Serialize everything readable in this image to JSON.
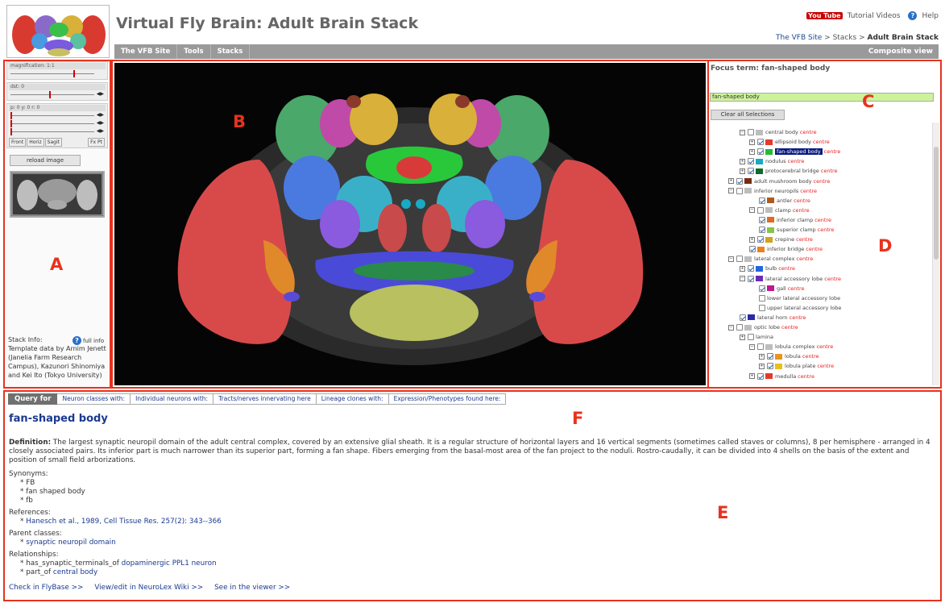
{
  "header": {
    "title": "Virtual Fly Brain: Adult Brain Stack",
    "tutorial_label": "Tutorial Videos",
    "help_label": "Help",
    "youtube_label": "You Tube",
    "breadcrumb": {
      "site": "The VFB Site",
      "sep1": ">",
      "stacks": "Stacks",
      "sep2": ">",
      "current": "Adult Brain Stack"
    }
  },
  "nav": {
    "items": [
      "The VFB Site",
      "Tools",
      "Stacks"
    ],
    "view_label": "Composite view"
  },
  "controls": {
    "magnification_label": "magnification: 1:1",
    "dst_label": "dst: 0",
    "pyr_label": "p: 0   y: 0   r: 0",
    "view_buttons": [
      "Front",
      "Horiz",
      "Sagit"
    ],
    "fx_button": "Fx Pt",
    "reload_button": "reload image"
  },
  "stack_info": {
    "label": "Stack Info:",
    "full_info": "full info",
    "text": "Template data by Arnim Jenett (Janelia Farm Research Campus), Kazunori Shinomiya and Kei Ito (Tokyo University)"
  },
  "focus": {
    "label": "Focus term: fan-shaped body",
    "input_value": "fan-shaped body",
    "clear_button": "Clear all Selections"
  },
  "tree": {
    "centre_label": "centre",
    "items": [
      {
        "label": "central body",
        "expander": "−",
        "checked": false,
        "color": "#bdbdbd",
        "centre": true
      },
      {
        "label": "ellipsoid body",
        "expander": "+",
        "checked": true,
        "color": "#e33b2e",
        "centre": true
      },
      {
        "label": "fan-shaped body",
        "expander": "+",
        "checked": true,
        "color": "#22bb33",
        "centre": true,
        "selected": true
      },
      {
        "label": "nodulus",
        "expander": "+",
        "checked": true,
        "color": "#18a9c4",
        "centre": true
      },
      {
        "label": "protocerebral bridge",
        "expander": "+",
        "checked": true,
        "color": "#0f6b2a",
        "centre": true
      },
      {
        "label": "adult mushroom body",
        "expander": "+",
        "checked": true,
        "color": "#7a2a14",
        "centre": true
      },
      {
        "label": "inferior neuropils",
        "expander": "−",
        "checked": false,
        "color": "#bdbdbd",
        "centre": true
      },
      {
        "label": "antler",
        "expander": "",
        "checked": true,
        "color": "#b05a1e",
        "centre": true
      },
      {
        "label": "clamp",
        "expander": "−",
        "checked": false,
        "color": "#bdbdbd",
        "centre": true
      },
      {
        "label": "inferior clamp",
        "expander": "",
        "checked": true,
        "color": "#e06a22",
        "centre": true
      },
      {
        "label": "superior clamp",
        "expander": "",
        "checked": true,
        "color": "#8bc34a",
        "centre": true
      },
      {
        "label": "crepine",
        "expander": "+",
        "checked": true,
        "color": "#d2a21a",
        "centre": true
      },
      {
        "label": "inferior bridge",
        "expander": "",
        "checked": true,
        "color": "#e8841e",
        "centre": true
      },
      {
        "label": "lateral complex",
        "expander": "−",
        "checked": false,
        "color": "#bdbdbd",
        "centre": true
      },
      {
        "label": "bulb",
        "expander": "+",
        "checked": true,
        "color": "#2266dd",
        "centre": true
      },
      {
        "label": "lateral accessory lobe",
        "expander": "−",
        "checked": true,
        "color": "#6a2bb5",
        "centre": true
      },
      {
        "label": "gall",
        "expander": "",
        "checked": true,
        "color": "#c2188d",
        "centre": true
      },
      {
        "label": "lower lateral accessory lobe",
        "expander": "",
        "checked": false,
        "color": "",
        "centre": false
      },
      {
        "label": "upper lateral accessory lobe",
        "expander": "",
        "checked": false,
        "color": "",
        "centre": false
      },
      {
        "label": "lateral horn",
        "expander": "",
        "checked": true,
        "color": "#2a2aa8",
        "centre": true
      },
      {
        "label": "optic lobe",
        "expander": "−",
        "checked": false,
        "color": "#bdbdbd",
        "centre": true
      },
      {
        "label": "lamina",
        "expander": "+",
        "checked": false,
        "color": "",
        "centre": false
      },
      {
        "label": "lobula complex",
        "expander": "−",
        "checked": false,
        "color": "#bdbdbd",
        "centre": true
      },
      {
        "label": "lobula",
        "expander": "+",
        "checked": true,
        "color": "#e8941e",
        "centre": true
      },
      {
        "label": "lobula plate",
        "expander": "+",
        "checked": true,
        "color": "#e8c01e",
        "centre": true
      },
      {
        "label": "medulla",
        "expander": "+",
        "checked": true,
        "color": "#e23a2a",
        "centre": true
      }
    ]
  },
  "query": {
    "query_for": "Query for",
    "tabs": [
      "Neuron classes with:",
      "Individual neurons with:",
      "Tracts/nerves innervating here",
      "Lineage clones with:",
      "Expression/Phenotypes found here:"
    ]
  },
  "term": {
    "name": "fan-shaped body",
    "definition_label": "Definition:",
    "definition": "The largest synaptic neuropil domain of the adult central complex, covered by an extensive glial sheath. It is a regular structure of horizontal layers and 16 vertical segments (sometimes called staves or columns), 8 per hemisphere - arranged in 4 closely associated pairs. Its inferior part is much narrower than its superior part, forming a fan shape. Fibers emerging from the basal-most area of the fan project to the noduli. Rostro-caudally, it can be divided into 4 shells on the basis of the extent and position of small field arborizations.",
    "synonyms_label": "Synonyms:",
    "synonyms": [
      "* FB",
      "* fan shaped body",
      "* fb"
    ],
    "references_label": "References:",
    "reference_bullet": "*",
    "reference": "Hanesch et al., 1989, Cell Tissue Res. 257(2): 343--366",
    "parents_label": "Parent classes:",
    "parent": "synaptic neuropil domain",
    "relationships_label": "Relationships:",
    "rel1_prefix": "* has_synaptic_terminals_of",
    "rel1_target": "dopaminergic PPL1 neuron",
    "rel2_prefix": "* part_of",
    "rel2_target": "central body"
  },
  "footer_links": [
    "Check in FlyBase >>",
    "View/edit in NeuroLex Wiki >>",
    "See in the viewer >>"
  ],
  "labels": {
    "A": "A",
    "B": "B",
    "C": "C",
    "D": "D",
    "E": "E",
    "F": "F"
  },
  "colors": {
    "box": "#e8321e",
    "link": "#1a3a8f",
    "nav": "#9a9a9a",
    "input": "#cdf39a"
  }
}
